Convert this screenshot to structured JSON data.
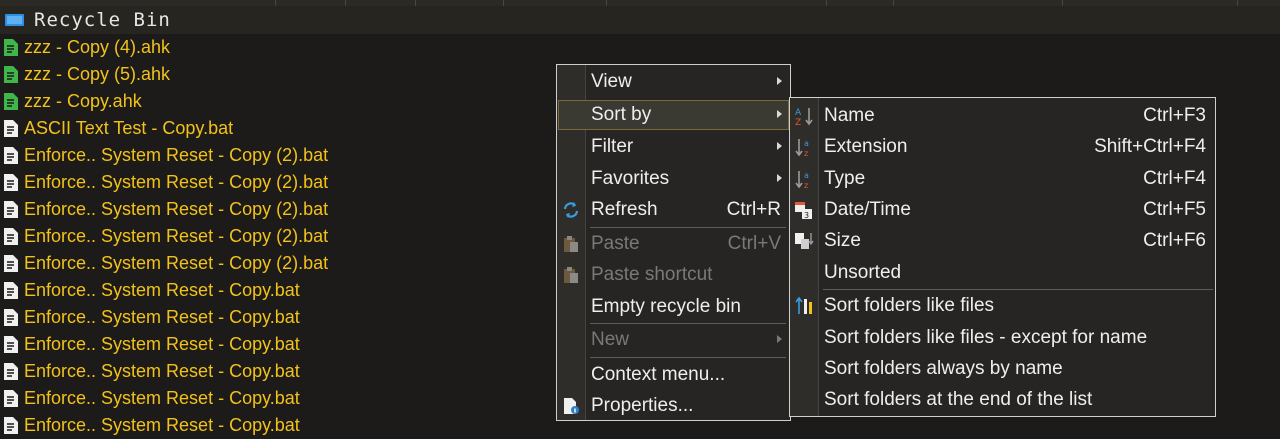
{
  "header": {
    "title": "Recycle Bin",
    "icon": "recycle-bin-icon"
  },
  "files": [
    {
      "name": "zzz - Copy (4).ahk",
      "icon": "ahk-script-icon",
      "icon_color": "#3fb54a"
    },
    {
      "name": "zzz - Copy (5).ahk",
      "icon": "ahk-script-icon",
      "icon_color": "#3fb54a"
    },
    {
      "name": "zzz - Copy.ahk",
      "icon": "ahk-script-icon",
      "icon_color": "#3fb54a"
    },
    {
      "name": "ASCII Text Test - Copy.bat",
      "icon": "bat-file-icon",
      "icon_color": "#f0f0f0"
    },
    {
      "name": "Enforce.. System Reset - Copy (2).bat",
      "icon": "bat-file-icon",
      "icon_color": "#f0f0f0"
    },
    {
      "name": "Enforce.. System Reset - Copy (2).bat",
      "icon": "bat-file-icon",
      "icon_color": "#f0f0f0"
    },
    {
      "name": "Enforce.. System Reset - Copy (2).bat",
      "icon": "bat-file-icon",
      "icon_color": "#f0f0f0"
    },
    {
      "name": "Enforce.. System Reset - Copy (2).bat",
      "icon": "bat-file-icon",
      "icon_color": "#f0f0f0"
    },
    {
      "name": "Enforce.. System Reset - Copy (2).bat",
      "icon": "bat-file-icon",
      "icon_color": "#f0f0f0"
    },
    {
      "name": "Enforce.. System Reset - Copy.bat",
      "icon": "bat-file-icon",
      "icon_color": "#f0f0f0"
    },
    {
      "name": "Enforce.. System Reset - Copy.bat",
      "icon": "bat-file-icon",
      "icon_color": "#f0f0f0"
    },
    {
      "name": "Enforce.. System Reset - Copy.bat",
      "icon": "bat-file-icon",
      "icon_color": "#f0f0f0"
    },
    {
      "name": "Enforce.. System Reset - Copy.bat",
      "icon": "bat-file-icon",
      "icon_color": "#f0f0f0"
    },
    {
      "name": "Enforce.. System Reset - Copy.bat",
      "icon": "bat-file-icon",
      "icon_color": "#f0f0f0"
    },
    {
      "name": "Enforce.. System Reset - Copy.bat",
      "icon": "bat-file-icon",
      "icon_color": "#f0f0f0"
    }
  ],
  "context_menu": {
    "items": [
      {
        "label": "View",
        "submenu": true
      },
      {
        "label": "Sort by",
        "submenu": true,
        "active": true
      },
      {
        "label": "Filter",
        "submenu": true
      },
      {
        "label": "Favorites",
        "submenu": true
      },
      {
        "label": "Refresh",
        "shortcut": "Ctrl+R",
        "icon": "refresh-icon"
      },
      {
        "label": "Paste",
        "shortcut": "Ctrl+V",
        "disabled": true,
        "icon": "paste-icon"
      },
      {
        "label": "Paste shortcut",
        "disabled": true,
        "icon": "paste-shortcut-icon"
      },
      {
        "label": "Empty recycle bin"
      },
      {
        "label": "New",
        "submenu": true,
        "disabled": true
      },
      {
        "label": "Context menu..."
      },
      {
        "label": "Properties...",
        "icon": "properties-icon"
      }
    ]
  },
  "sort_submenu": {
    "items": [
      {
        "label": "Name",
        "shortcut": "Ctrl+F3",
        "icon": "sort-by-name-icon"
      },
      {
        "label": "Extension",
        "shortcut": "Shift+Ctrl+F4",
        "icon": "sort-by-extension-icon"
      },
      {
        "label": "Type",
        "shortcut": "Ctrl+F4",
        "icon": "sort-by-type-icon"
      },
      {
        "label": "Date/Time",
        "shortcut": "Ctrl+F5",
        "icon": "sort-by-date-icon"
      },
      {
        "label": "Size",
        "shortcut": "Ctrl+F6",
        "icon": "sort-by-size-icon"
      },
      {
        "label": "Unsorted"
      },
      {
        "label": "Sort folders like files",
        "icon": "sort-folders-icon"
      },
      {
        "label": "Sort folders like files - except for name"
      },
      {
        "label": "Sort folders always by name"
      },
      {
        "label": "Sort folders at the end of the list"
      }
    ]
  },
  "colors": {
    "file_text": "#f2c21b",
    "background": "#1c1b19",
    "menu_bg": "#262523",
    "menu_border": "#cfcfcf"
  }
}
